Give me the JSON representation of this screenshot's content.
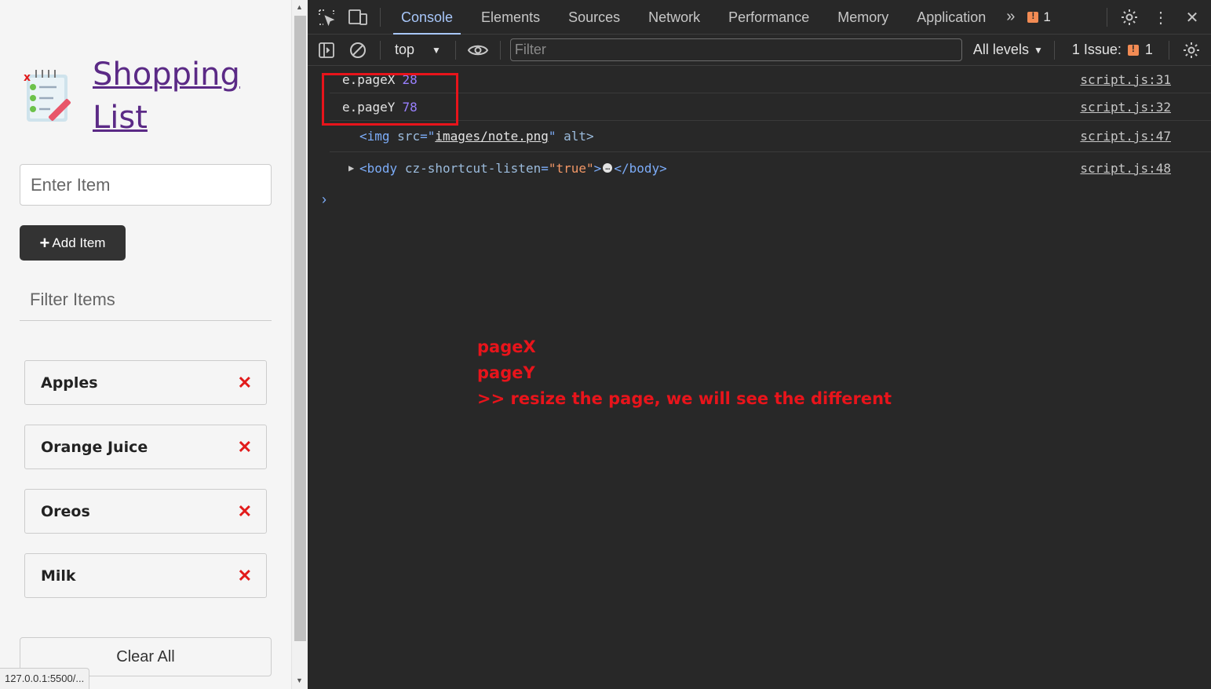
{
  "page": {
    "title": "Shopping List",
    "item_input_placeholder": "Enter Item",
    "add_button_label": "Add Item",
    "filter_placeholder": "Filter Items",
    "items": [
      "Apples",
      "Orange Juice",
      "Oreos",
      "Milk"
    ],
    "remove_glyph": "✕",
    "clear_button_label": "Clear All",
    "status_url": "127.0.0.1:5500/..."
  },
  "devtools": {
    "tabs": [
      "Console",
      "Elements",
      "Sources",
      "Network",
      "Performance",
      "Memory",
      "Application"
    ],
    "active_tab": "Console",
    "issues_badge_count": "1",
    "context": "top",
    "filter_placeholder": "Filter",
    "levels": "All levels",
    "issues_label": "1 Issue:",
    "issues_count": "1",
    "logs": [
      {
        "label": "e.pageX",
        "value": "28",
        "source": "script.js:31"
      },
      {
        "label": "e.pageY",
        "value": "78",
        "source": "script.js:32"
      },
      {
        "tag_open": "<img",
        "attr": "src",
        "eq": "=\"",
        "val": "images/note.png",
        "close": "\"",
        "extra": "alt>",
        "source": "script.js:47"
      },
      {
        "tag_open": "<body",
        "attr": "cz-shortcut-listen",
        "eq": "=",
        "val": "\"true\"",
        "close": ">",
        "ellipsis": "…",
        "end": "</body>",
        "source": "script.js:48"
      }
    ],
    "prompt_glyph": "›"
  },
  "annotation": {
    "line1": "pageX",
    "line2": "pageY",
    "line3": ">> resize the page, we will see the different"
  },
  "colors": {
    "accent": "#a8c7fa",
    "annotation_red": "#e8141b",
    "title_purple": "#5b2a86",
    "console_number": "#9980ff"
  }
}
